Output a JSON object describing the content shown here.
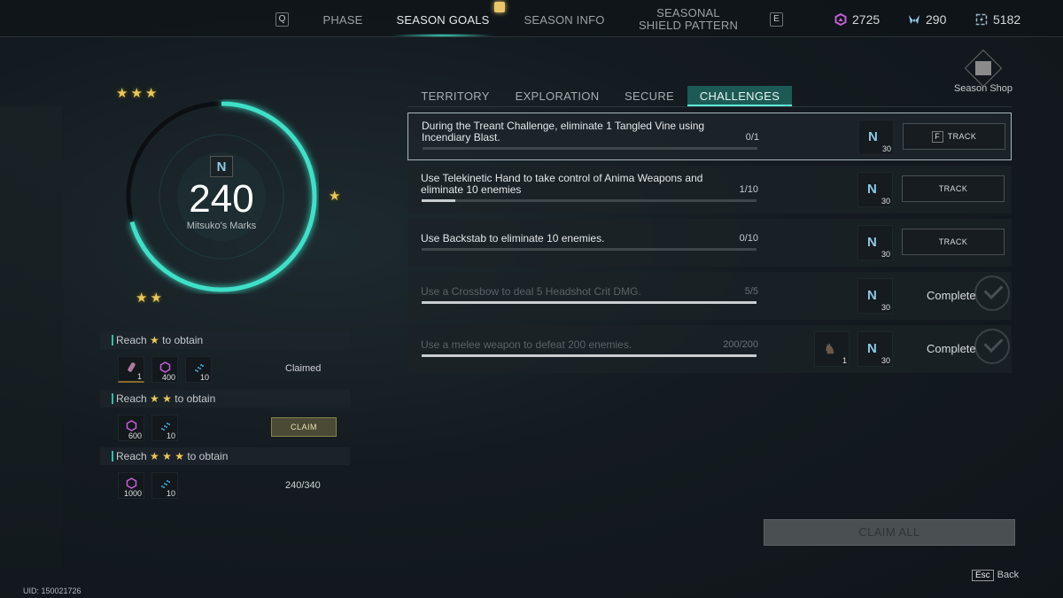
{
  "topnav": {
    "left_key": "Q",
    "right_key": "E",
    "tabs": [
      {
        "label": "PHASE",
        "active": false
      },
      {
        "label": "SEASON GOALS",
        "active": true
      },
      {
        "label": "SEASON INFO",
        "active": false
      },
      {
        "label": "SEASONAL\nSHIELD PATTERN",
        "active": false
      }
    ]
  },
  "currencies": [
    {
      "icon": "purple-hexagon-icon",
      "value": "2725",
      "color": "#c65fd6"
    },
    {
      "icon": "mitsuko-mark-icon",
      "value": "290",
      "color": "#8fc9e6"
    },
    {
      "icon": "energy-box-icon",
      "value": "5182",
      "color": "#9fb8c4"
    }
  ],
  "season_shop": {
    "label": "Season Shop"
  },
  "marks": {
    "value": "240",
    "label": "Mitsuko's Marks",
    "progress_fraction": 0.706,
    "accent": "#3fe0c8"
  },
  "star_rewards": [
    {
      "heading_pre": "Reach",
      "stars": "★",
      "heading_post": "to obtain",
      "items": [
        {
          "icon": "consumable-vial-icon",
          "count": "1"
        },
        {
          "icon": "purple-hexagon-icon",
          "count": "400"
        },
        {
          "icon": "blue-shards-icon",
          "count": "10"
        }
      ],
      "status": "Claimed"
    },
    {
      "heading_pre": "Reach",
      "stars": "★ ★",
      "heading_post": "to obtain",
      "items": [
        {
          "icon": "purple-hexagon-icon",
          "count": "600"
        },
        {
          "icon": "blue-shards-icon",
          "count": "10"
        }
      ],
      "button": "CLAIM"
    },
    {
      "heading_pre": "Reach",
      "stars": "★ ★ ★",
      "heading_post": "to obtain",
      "items": [
        {
          "icon": "purple-hexagon-icon",
          "count": "1000"
        },
        {
          "icon": "blue-shards-icon",
          "count": "10"
        }
      ],
      "status": "240/340"
    }
  ],
  "subtabs": [
    {
      "label": "TERRITORY",
      "active": false
    },
    {
      "label": "EXPLORATION",
      "active": false
    },
    {
      "label": "SECURE",
      "active": false
    },
    {
      "label": "CHALLENGES",
      "active": true
    }
  ],
  "challenges": [
    {
      "desc": "During the Treant Challenge, eliminate 1 Tangled Vine using Incendiary Blast.",
      "progress": "0/1",
      "fraction": 0,
      "reward_count": "30",
      "action": "TRACK",
      "action_key": "F",
      "selected": true,
      "done": false
    },
    {
      "desc": "Use Telekinetic Hand to take control of Anima Weapons and eliminate 10 enemies",
      "progress": "1/10",
      "fraction": 0.1,
      "reward_count": "30",
      "action": "TRACK",
      "selected": false,
      "done": false
    },
    {
      "desc": "Use Backstab to eliminate 10 enemies.",
      "progress": "0/10",
      "fraction": 0,
      "reward_count": "30",
      "action": "TRACK",
      "selected": false,
      "done": false
    },
    {
      "desc": "Use a Crossbow to deal 5 Headshot Crit DMG.",
      "progress": "5/5",
      "fraction": 1,
      "reward_count": "30",
      "status": "Complete",
      "selected": false,
      "done": true
    },
    {
      "desc": "Use a melee weapon to defeat 200 enemies.",
      "progress": "200/200",
      "fraction": 1,
      "reward_count": "30",
      "extra_reward_count": "1",
      "status": "Complete",
      "selected": false,
      "done": true
    }
  ],
  "claim_all": "CLAIM ALL",
  "back": {
    "key": "Esc",
    "label": "Back"
  },
  "uid": "UID: 150021726"
}
